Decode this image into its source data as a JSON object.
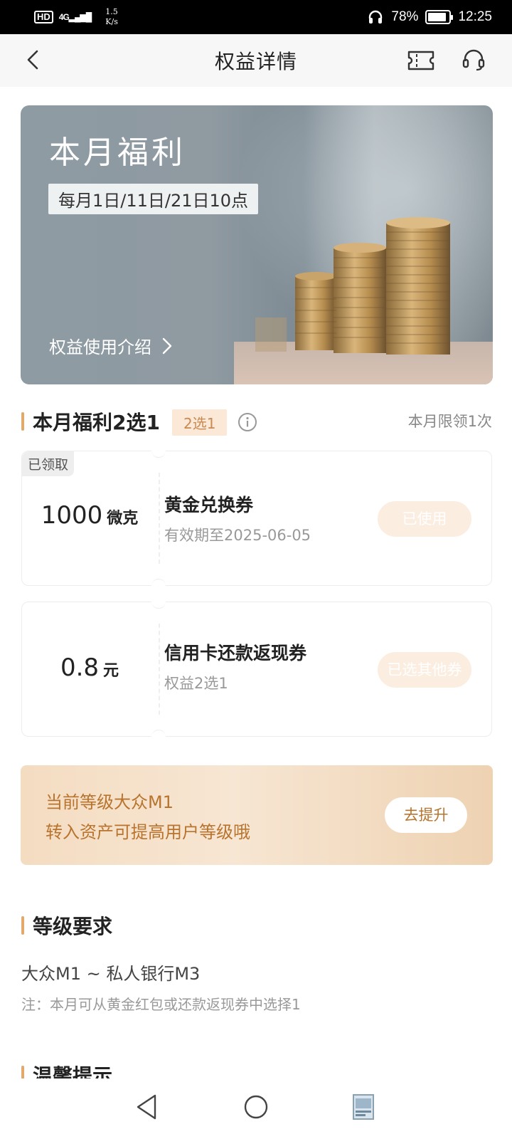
{
  "status_bar": {
    "hd": "HD",
    "network": "4G",
    "speed_value": "1.5",
    "speed_unit": "K/s",
    "battery": "78%",
    "time": "12:25"
  },
  "header": {
    "title": "权益详情"
  },
  "banner": {
    "title": "本月福利",
    "date": "每月1日/11日/21日10点",
    "link": "权益使用介绍"
  },
  "benefit_section": {
    "title": "本月福利2选1",
    "tag": "2选1",
    "limit": "本月限领1次"
  },
  "coupons": [
    {
      "received_tag": "已领取",
      "amount": "1000",
      "unit": "微克",
      "name": "黄金兑换券",
      "desc": "有效期至2025-06-05",
      "button": "已使用"
    },
    {
      "amount": "0.8",
      "unit": "元",
      "name": "信用卡还款返现券",
      "desc": "权益2选1",
      "button": "已选其他券"
    }
  ],
  "upgrade": {
    "line1": "当前等级大众M1",
    "line2": "转入资产可提高用户等级哦",
    "button": "去提升"
  },
  "level_section": {
    "title": "等级要求",
    "range": "大众M1 ~ 私人银行M3",
    "note": "注：本月可从黄金红包或还款返现券中选择1"
  },
  "tips_section": {
    "title": "温馨提示"
  },
  "colors": {
    "accent": "#e2a86c",
    "gold_text": "#b8742e",
    "tag_bg": "#fbe8d6"
  }
}
